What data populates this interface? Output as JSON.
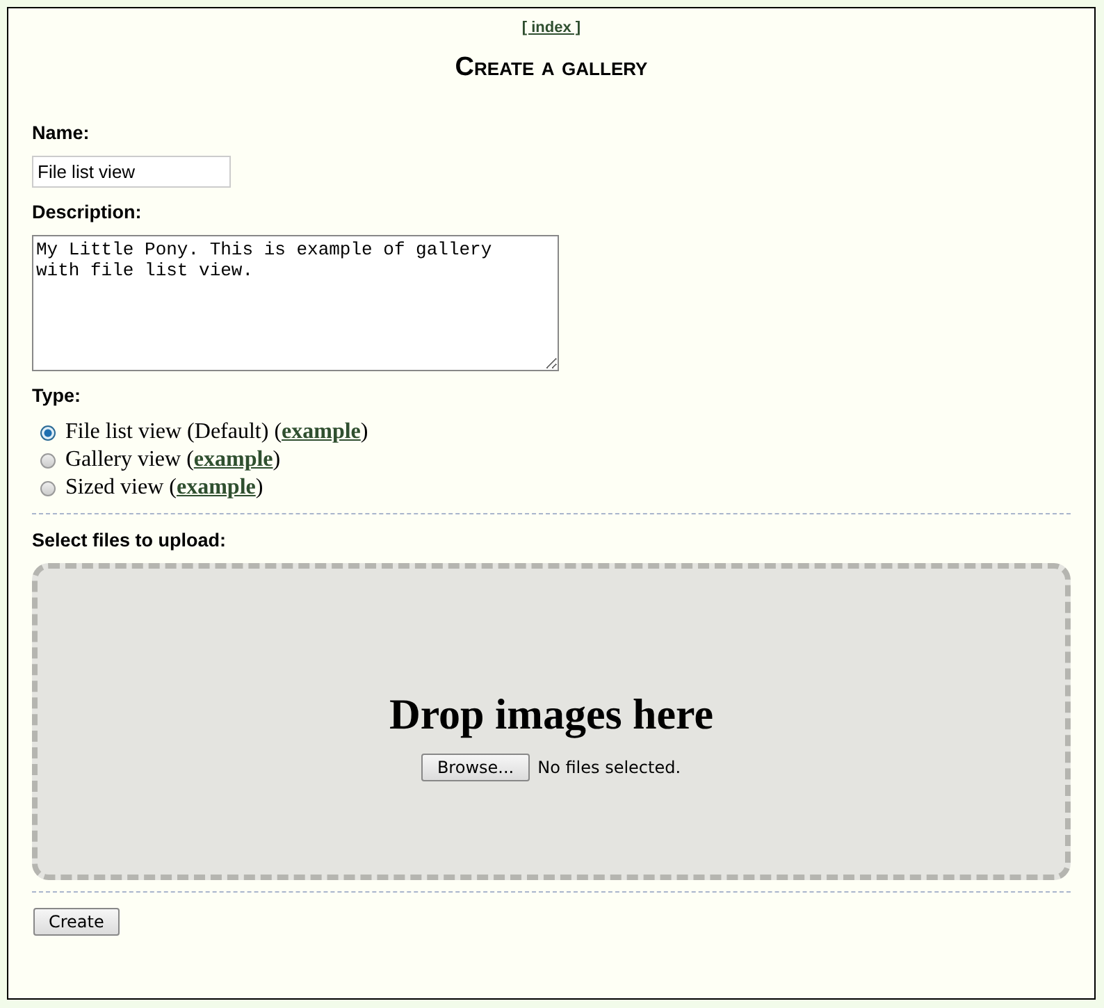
{
  "nav_link": "[ index ]",
  "title": "Create a gallery",
  "name_field": {
    "label": "Name:",
    "value": "File list view"
  },
  "description_field": {
    "label": "Description:",
    "value": "My Little Pony. This is example of gallery\nwith file list view."
  },
  "type": {
    "label": "Type:",
    "options": [
      {
        "before": "File list view (Default) (",
        "link": "example",
        "after": ")",
        "selected": true
      },
      {
        "before": "Gallery view (",
        "link": "example",
        "after": ")",
        "selected": false
      },
      {
        "before": "Sized view (",
        "link": "example",
        "after": ")",
        "selected": false
      }
    ]
  },
  "upload": {
    "label": "Select files to upload:",
    "drop_text": "Drop images here",
    "browse_button": "Browse...",
    "file_status": "No files selected."
  },
  "submit_button": "Create"
}
